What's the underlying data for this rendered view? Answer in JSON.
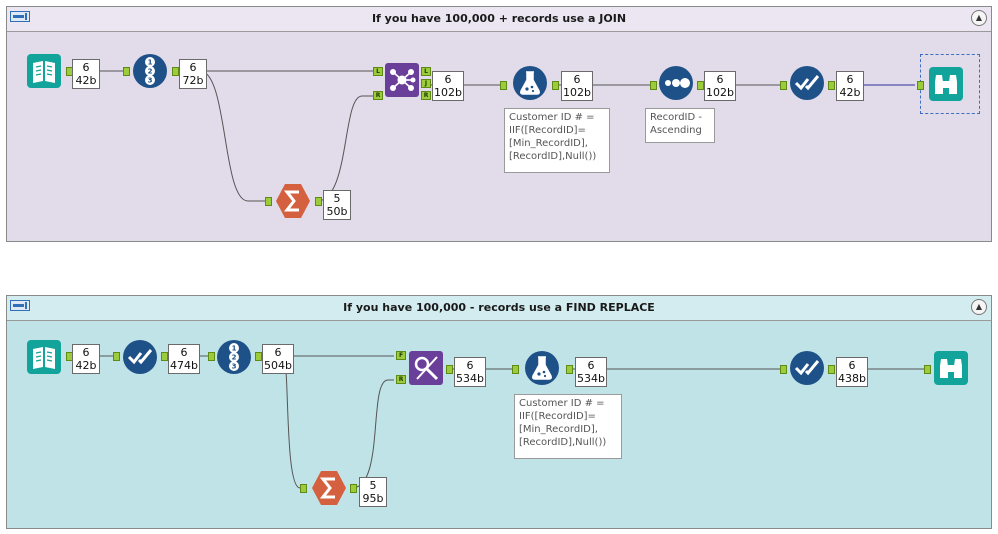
{
  "containers": [
    {
      "title": "If you have 100,000 + records use a JOIN",
      "collapse_icon": "collapse-up-icon",
      "tools": [
        {
          "name": "input-data-tool",
          "icon": "book-icon",
          "color": "#12a39a",
          "badge": [
            "6",
            "42b"
          ]
        },
        {
          "name": "record-id-tool",
          "icon": "numbered-circles-icon",
          "color": "#1e5187",
          "badge": [
            "6",
            "72b"
          ]
        },
        {
          "name": "summarize-tool",
          "icon": "sigma-icon",
          "color": "#d4603f",
          "badge": [
            "5",
            "50b"
          ]
        },
        {
          "name": "join-tool",
          "icon": "join-icon",
          "color": "#6a3f99",
          "badge": [
            "6",
            "102b"
          ],
          "anchors": [
            "L",
            "R",
            "L",
            "J",
            "R"
          ]
        },
        {
          "name": "formula-tool",
          "icon": "flask-icon",
          "color": "#1e5187",
          "badge": [
            "6",
            "102b"
          ],
          "annotation": "Customer ID # =\nIIF([RecordID]=\n[Min_RecordID],\n[RecordID],Null())"
        },
        {
          "name": "sort-tool",
          "icon": "dots-icon",
          "color": "#1e5187",
          "badge": [
            "6",
            "102b"
          ],
          "annotation": "RecordID -\nAscending"
        },
        {
          "name": "select-tool",
          "icon": "checkmark-icon",
          "color": "#1e5187",
          "badge": [
            "6",
            "42b"
          ]
        },
        {
          "name": "browse-tool",
          "icon": "binoculars-icon",
          "color": "#12a39a"
        }
      ]
    },
    {
      "title": "If you have 100,000 - records use a FIND REPLACE",
      "collapse_icon": "collapse-up-icon",
      "tools": [
        {
          "name": "input-data-tool",
          "icon": "book-icon",
          "color": "#12a39a",
          "badge": [
            "6",
            "42b"
          ]
        },
        {
          "name": "select-tool",
          "icon": "checkmark-icon",
          "color": "#1e5187",
          "badge": [
            "6",
            "474b"
          ]
        },
        {
          "name": "record-id-tool",
          "icon": "numbered-circles-icon",
          "color": "#1e5187",
          "badge": [
            "6",
            "504b"
          ]
        },
        {
          "name": "summarize-tool",
          "icon": "sigma-icon",
          "color": "#d4603f",
          "badge": [
            "5",
            "95b"
          ]
        },
        {
          "name": "find-replace-tool",
          "icon": "find-replace-icon",
          "color": "#6a3f99",
          "badge": [
            "6",
            "534b"
          ],
          "anchors": [
            "F",
            "R"
          ]
        },
        {
          "name": "formula-tool",
          "icon": "flask-icon",
          "color": "#1e5187",
          "badge": [
            "6",
            "534b"
          ],
          "annotation": "Customer ID # =\nIIF([RecordID]=\n[Min_RecordID],\n[RecordID],Null())"
        },
        {
          "name": "select-tool",
          "icon": "checkmark-icon",
          "color": "#1e5187",
          "badge": [
            "6",
            "438b"
          ]
        },
        {
          "name": "browse-tool",
          "icon": "binoculars-icon",
          "color": "#12a39a"
        }
      ]
    }
  ]
}
